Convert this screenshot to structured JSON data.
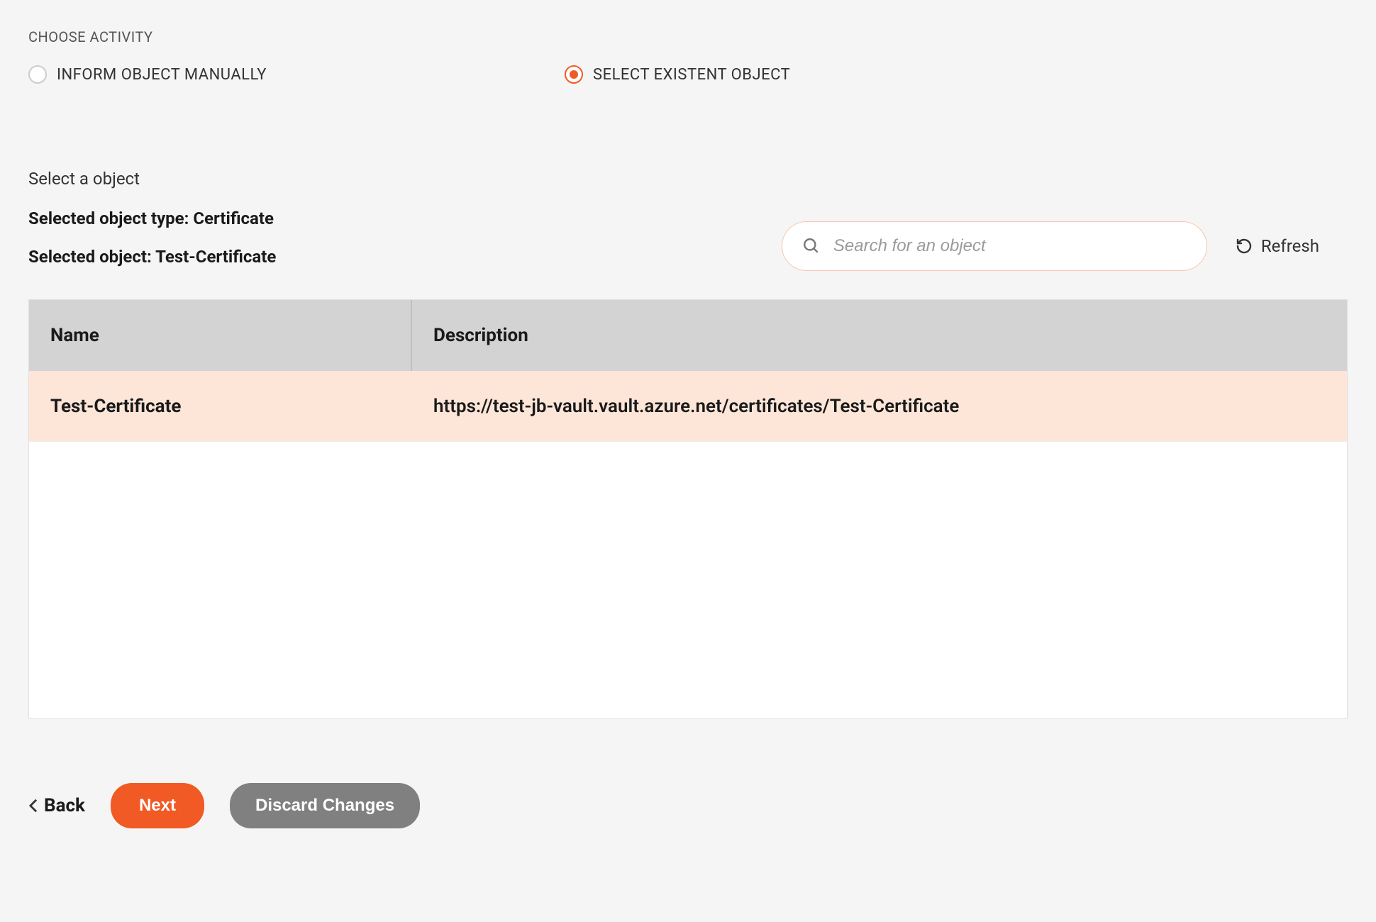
{
  "header": {
    "section_label": "CHOOSE ACTIVITY"
  },
  "radios": {
    "manual": {
      "label": "INFORM OBJECT MANUALLY",
      "selected": false
    },
    "existent": {
      "label": "SELECT EXISTENT OBJECT",
      "selected": true
    }
  },
  "selection": {
    "title": "Select a object",
    "type_line": "Selected object type: Certificate",
    "object_line": "Selected object: Test-Certificate"
  },
  "search": {
    "placeholder": "Search for an object"
  },
  "refresh": {
    "label": "Refresh"
  },
  "table": {
    "columns": {
      "name": "Name",
      "description": "Description"
    },
    "rows": [
      {
        "name": "Test-Certificate",
        "description": "https://test-jb-vault.vault.azure.net/certificates/Test-Certificate",
        "selected": true
      }
    ]
  },
  "footer": {
    "back": "Back",
    "next": "Next",
    "discard": "Discard Changes"
  }
}
